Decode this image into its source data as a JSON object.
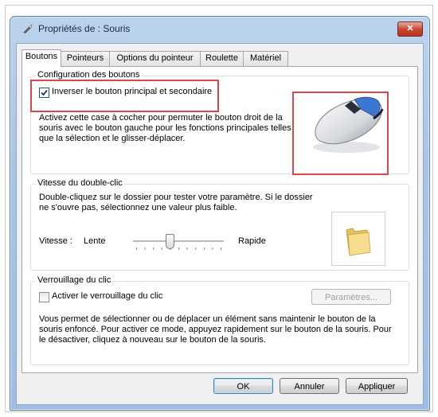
{
  "window": {
    "title": "Propriétés de : Souris"
  },
  "tabs": [
    "Boutons",
    "Pointeurs",
    "Options du pointeur",
    "Roulette",
    "Matériel"
  ],
  "buttons_config": {
    "group_label": "Configuration des boutons",
    "checkbox_label": "Inverser le bouton principal et secondaire",
    "checked": true,
    "description": "Activez cette case à cocher pour permuter le bouton droit de la souris avec le bouton gauche pour les fonctions principales telles que la sélection et le glisser-déplacer."
  },
  "double_click": {
    "group_label": "Vitesse du double-clic",
    "description": "Double-cliquez sur le dossier pour tester votre paramètre. Si le dossier ne s'ouvre pas, sélectionnez une valeur plus faible.",
    "speed_label": "Vitesse :",
    "slow_label": "Lente",
    "fast_label": "Rapide",
    "slider_value": 0.4
  },
  "click_lock": {
    "group_label": "Verrouillage du clic",
    "checkbox_label": "Activer le verrouillage du clic",
    "checked": false,
    "settings_button": "Paramètres...",
    "description": "Vous permet de sélectionner ou de déplacer un élément sans maintenir le bouton de la souris enfoncé. Pour activer ce mode, appuyez rapidement sur le bouton de la souris. Pour le désactiver, cliquez à nouveau sur le bouton de la souris."
  },
  "footer": {
    "ok": "OK",
    "cancel": "Annuler",
    "apply": "Appliquer"
  },
  "colors": {
    "highlight_box": "#d9474a",
    "titlebar": "#a9c4e4",
    "close": "#c8432f"
  }
}
